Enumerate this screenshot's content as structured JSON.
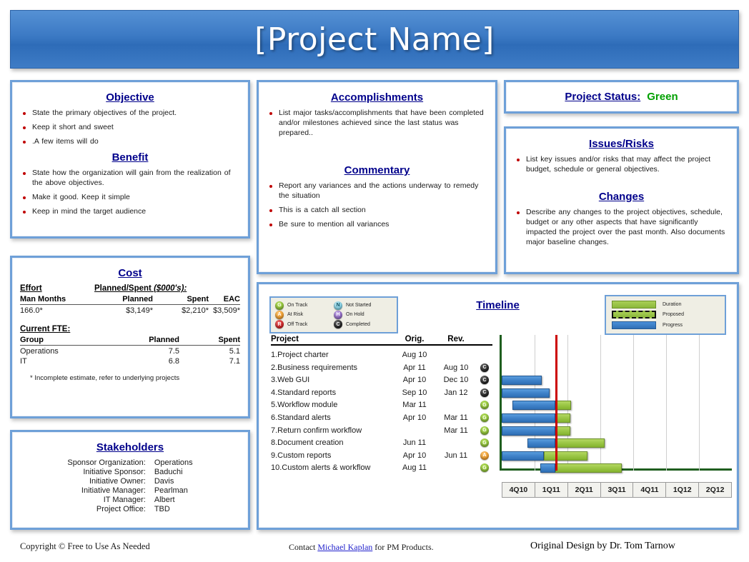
{
  "header": {
    "title": "[Project Name]"
  },
  "objective": {
    "title": "Objective",
    "items": [
      "State the primary objectives of the project.",
      "Keep it short and sweet",
      ".A few items will do"
    ]
  },
  "benefit": {
    "title": "Benefit",
    "items": [
      "State how the organization will gain from the realization of the above objectives.",
      "Make it good. Keep it simple",
      "Keep in mind the target audience"
    ]
  },
  "cost": {
    "title": "Cost",
    "effort_label": "Effort",
    "planned_spent_label": "Planned/Spent ",
    "planned_spent_units": "($000's):",
    "effort_table": {
      "headers": [
        "Man Months",
        "Planned",
        "Spent",
        "EAC"
      ],
      "row": [
        "166.0*",
        "$3,149*",
        "$2,210*",
        "$3,509*"
      ]
    },
    "fte_label": "Current FTE:",
    "fte_table": {
      "headers": [
        "Group",
        "Planned",
        "Spent"
      ],
      "rows": [
        [
          "Operations",
          "7.5",
          "5.1"
        ],
        [
          "IT",
          "6.8",
          "7.1"
        ]
      ]
    },
    "note": "* Incomplete estimate, refer to underlying projects"
  },
  "stakeholders": {
    "title": "Stakeholders",
    "rows": [
      {
        "key": "Sponsor Organization:",
        "value": "Operations"
      },
      {
        "key": "Initiative Sponsor:",
        "value": "Baduchi"
      },
      {
        "key": "Initiative Owner:",
        "value": "Davis"
      },
      {
        "key": "Initiative Manager:",
        "value": "Pearlman"
      },
      {
        "key": "IT Manager:",
        "value": "Albert"
      },
      {
        "key": "Project Office:",
        "value": "TBD"
      }
    ]
  },
  "accomplishments": {
    "title": "Accomplishments",
    "items": [
      "List major tasks/accomplishments that have been completed and/or milestones achieved since the last status was prepared.."
    ]
  },
  "commentary": {
    "title": "Commentary",
    "items": [
      "Report any variances and the actions underway to remedy the situation",
      "This is a catch all section",
      "Be sure to mention all variances"
    ]
  },
  "project_status": {
    "label": "Project Status:",
    "value": "Green",
    "color": "#00a000"
  },
  "issues_risks": {
    "title": "Issues/Risks",
    "items": [
      "List key issues and/or risks that may affect the project budget, schedule or general objectives."
    ]
  },
  "changes": {
    "title": "Changes",
    "items": [
      "Describe any changes to the project objectives, schedule, budget or any other aspects that have significantly impacted the project over the past month. Also documents major baseline changes."
    ]
  },
  "timeline": {
    "title": "Timeline",
    "status_legend": [
      {
        "code": "G",
        "kind": "g",
        "label": "On Track"
      },
      {
        "code": "A",
        "kind": "a",
        "label": "At Risk"
      },
      {
        "code": "R",
        "kind": "r",
        "label": "Off Track"
      },
      {
        "code": "N",
        "kind": "n",
        "label": "Not Started"
      },
      {
        "code": "H",
        "kind": "h",
        "label": "On Hold"
      },
      {
        "code": "C",
        "kind": "c",
        "label": "Completed"
      }
    ],
    "bar_legend": [
      {
        "swatch": "sw-duration",
        "label": "Duration"
      },
      {
        "swatch": "sw-proposed",
        "label": "Proposed"
      },
      {
        "swatch": "sw-progress",
        "label": "Progress"
      }
    ],
    "columns": [
      "Project",
      "Orig.",
      "Rev.",
      ""
    ],
    "tasks": [
      {
        "name": "1.Project charter",
        "orig": "Aug 10",
        "rev": "",
        "status": "",
        "status_kind": ""
      },
      {
        "name": "2.Business requirements",
        "orig": "Apr 11",
        "rev": "Aug 10",
        "status": "C",
        "status_kind": "c"
      },
      {
        "name": "3.Web GUI",
        "orig": "Apr 10",
        "rev": "Dec 10",
        "status": "C",
        "status_kind": "c"
      },
      {
        "name": "4.Standard reports",
        "orig": "Sep 10",
        "rev": "Jan 12",
        "status": "C",
        "status_kind": "c"
      },
      {
        "name": "5.Workflow module",
        "orig": "Mar 11",
        "rev": "",
        "status": "G",
        "status_kind": "g"
      },
      {
        "name": "6.Standard alerts",
        "orig": "Apr 10",
        "rev": "Mar 11",
        "status": "G",
        "status_kind": "g"
      },
      {
        "name": "7.Return confirm workflow",
        "orig": "",
        "rev": "Mar 11",
        "status": "G",
        "status_kind": "g"
      },
      {
        "name": "8.Document creation",
        "orig": "Jun 11",
        "rev": "",
        "status": "G",
        "status_kind": "g"
      },
      {
        "name": "9.Custom reports",
        "orig": "Apr 10",
        "rev": "Jun 11",
        "status": "A",
        "status_kind": "a"
      },
      {
        "name": "10.Custom alerts & workflow",
        "orig": "Aug 11",
        "rev": "",
        "status": "G",
        "status_kind": "g"
      }
    ],
    "quarters": [
      "4Q10",
      "1Q11",
      "2Q11",
      "3Q11",
      "4Q11",
      "1Q12",
      "2Q12"
    ],
    "today_marker_quarter_fraction": 1.63
  },
  "chart_data": {
    "type": "bar",
    "title": "Timeline",
    "xlabel": "",
    "ylabel": "",
    "categories": [
      "4Q10",
      "1Q11",
      "2Q11",
      "3Q11",
      "4Q11",
      "1Q12",
      "2Q12"
    ],
    "axis_range_quarters": [
      0,
      7
    ],
    "grid": true,
    "legend": [
      "Duration",
      "Proposed",
      "Progress"
    ],
    "today_line_at_quarter": 1.63,
    "bars": [
      {
        "task": "1.Project charter",
        "progress": null,
        "duration": null
      },
      {
        "task": "2.Business requirements",
        "progress": null,
        "duration": null
      },
      {
        "task": "3.Web GUI",
        "progress": [
          0.0,
          1.22
        ],
        "duration": null
      },
      {
        "task": "4.Standard reports",
        "progress": [
          0.0,
          1.45
        ],
        "duration": null
      },
      {
        "task": "5.Workflow module",
        "progress": [
          0.33,
          1.63
        ],
        "duration": [
          1.63,
          2.1
        ]
      },
      {
        "task": "6.Standard alerts",
        "progress": [
          0.0,
          1.63
        ],
        "duration": [
          1.63,
          2.08
        ]
      },
      {
        "task": "7.Return confirm workflow",
        "progress": [
          0.0,
          1.63
        ],
        "duration": [
          1.63,
          2.08
        ]
      },
      {
        "task": "8.Document creation",
        "progress": [
          0.78,
          1.63
        ],
        "duration": [
          1.63,
          3.12
        ]
      },
      {
        "task": "9.Custom reports",
        "progress": [
          0.0,
          1.28
        ],
        "duration": [
          1.28,
          2.6
        ]
      },
      {
        "task": "10.Custom alerts & workflow",
        "progress": [
          1.17,
          1.63
        ],
        "duration": [
          1.63,
          3.65
        ]
      }
    ]
  },
  "footer": {
    "copyright": "Copyright © Free to Use As Needed",
    "contact_prefix": "Contact ",
    "contact_link": "Michael Kaplan",
    "contact_suffix": " for PM Products.",
    "design_credit": "Original Design by Dr. Tom Tarnow"
  }
}
